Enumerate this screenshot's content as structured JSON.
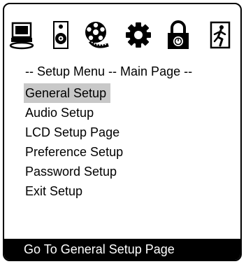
{
  "icons": [
    "computer-icon",
    "speaker-icon",
    "film-reel-icon",
    "settings-icon",
    "lock-icon",
    "exit-icon"
  ],
  "header_line": "--  Setup Menu --  Main Page  --",
  "menu": {
    "selected_index": 0,
    "items": [
      {
        "label": "General Setup"
      },
      {
        "label": "Audio Setup"
      },
      {
        "label": "LCD Setup Page"
      },
      {
        "label": "Preference Setup"
      },
      {
        "label": "Password Setup"
      },
      {
        "label": "Exit Setup"
      }
    ]
  },
  "status_bar": {
    "text": "Go To General Setup Page"
  }
}
